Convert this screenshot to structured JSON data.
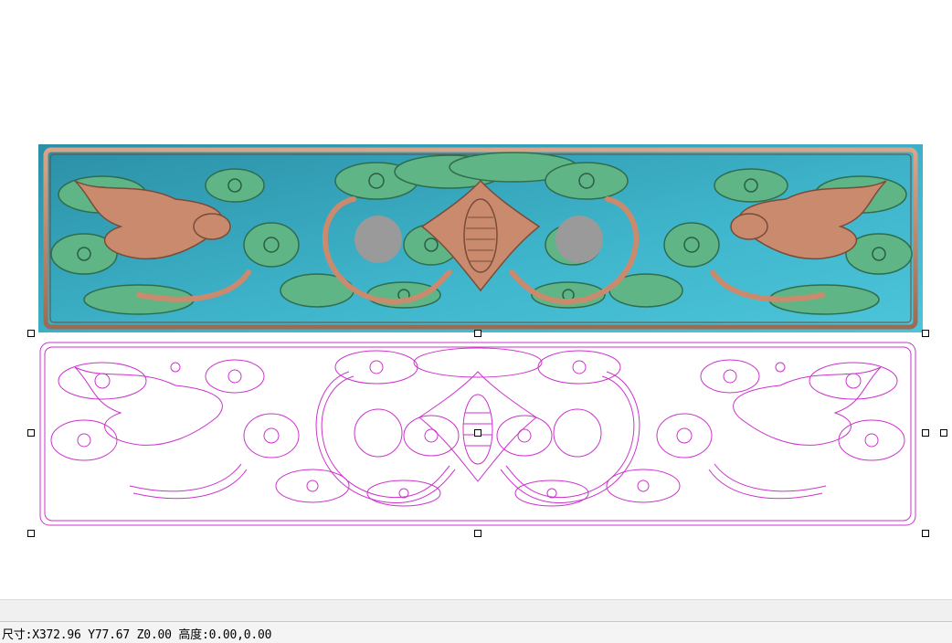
{
  "app": {
    "status": {
      "size_readout": "尺寸:X372.96 Y77.67 Z0.00 高度:0.00,0.00"
    }
  },
  "canvas": {
    "relief_model": {
      "icon": "carved-bat-cloud-relief-panel"
    },
    "vector_outline": {
      "icon": "bat-cloud-vector-outline"
    }
  },
  "colors": {
    "relief_background": "#36a8bd",
    "relief_green": "#5fb586",
    "relief_copper": "#c98a6e",
    "vector_line": "#cc33cc",
    "hole_gray": "#9a9a9a"
  }
}
